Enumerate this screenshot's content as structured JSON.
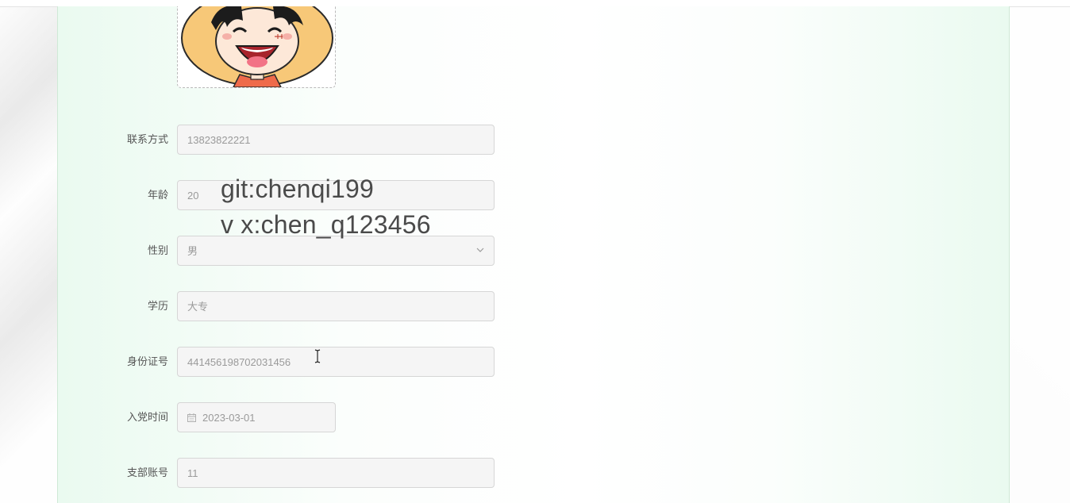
{
  "form": {
    "fields": [
      {
        "label": "联系方式",
        "value": "13823822221"
      },
      {
        "label": "年龄",
        "value": "20"
      },
      {
        "label": "性别",
        "value": "男"
      },
      {
        "label": "学历",
        "value": "大专"
      },
      {
        "label": "身份证号",
        "value": "441456198702031456"
      },
      {
        "label": "入党时间",
        "value": "2023-03-01"
      },
      {
        "label": "支部账号",
        "value": "11"
      }
    ]
  },
  "watermark": {
    "line1": "git:chenqi199",
    "line2": "v x:chen_q123456"
  },
  "icons": {
    "select": "chevron-down-icon",
    "date": "calendar-icon",
    "cursor": "text-cursor-icon"
  },
  "colors": {
    "panel_tint": "#eafaf0",
    "input_bg": "#f5f5f5",
    "input_border": "#d6d6d6",
    "label_text": "#555555",
    "value_text": "#9a9a9a"
  }
}
